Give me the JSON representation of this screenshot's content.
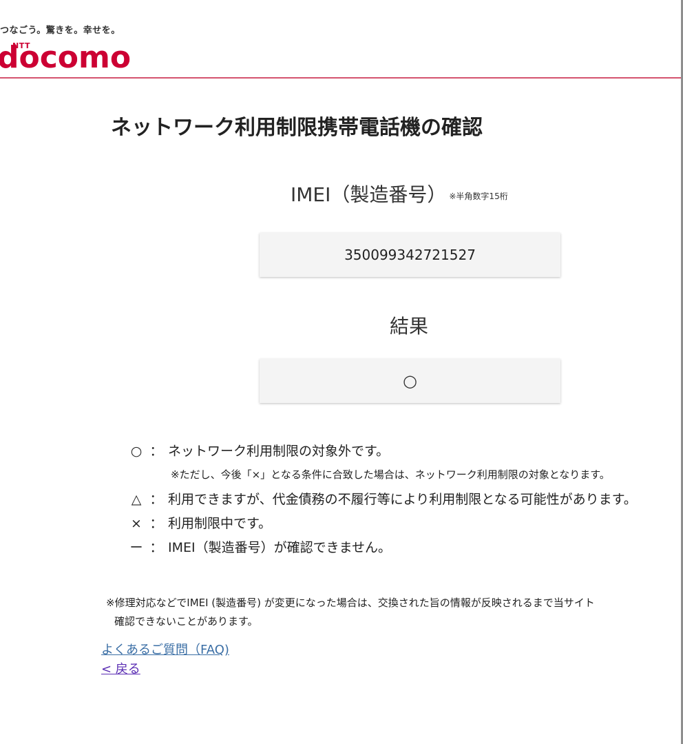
{
  "header": {
    "tagline": "つなごう。驚きを。幸せを。",
    "logo_small": "NTT",
    "logo_text": "docomo"
  },
  "main": {
    "title": "ネットワーク利用制限携帯電話機の確認",
    "imei_label": "IMEI（製造番号）",
    "imei_note": "※半角数字15桁",
    "imei_value": "350099342721527",
    "result_label": "結果",
    "result_value": "○"
  },
  "legend": {
    "items": [
      {
        "symbol": "○",
        "colon": "：",
        "text": "ネットワーク利用制限の対象外です。"
      },
      {
        "symbol": "△",
        "colon": "：",
        "text": "利用できますが、代金債務の不履行等により利用制限となる可能性があります。"
      },
      {
        "symbol": "×",
        "colon": "：",
        "text": "利用制限中です。"
      },
      {
        "symbol": "ー",
        "colon": "：",
        "text": "IMEI（製造番号）が確認できません。"
      }
    ],
    "note": "※ただし、今後「×」となる条件に合致した場合は、ネットワーク利用制限の対象となります。"
  },
  "footnote": {
    "line1": "※修理対応などでIMEI (製造番号) が変更になった場合は、交換された旨の情報が反映されるまで当サイト",
    "line2": "確認できないことがあります。"
  },
  "links": {
    "faq": "よくあるご質問（FAQ)",
    "back": "< 戻る"
  }
}
